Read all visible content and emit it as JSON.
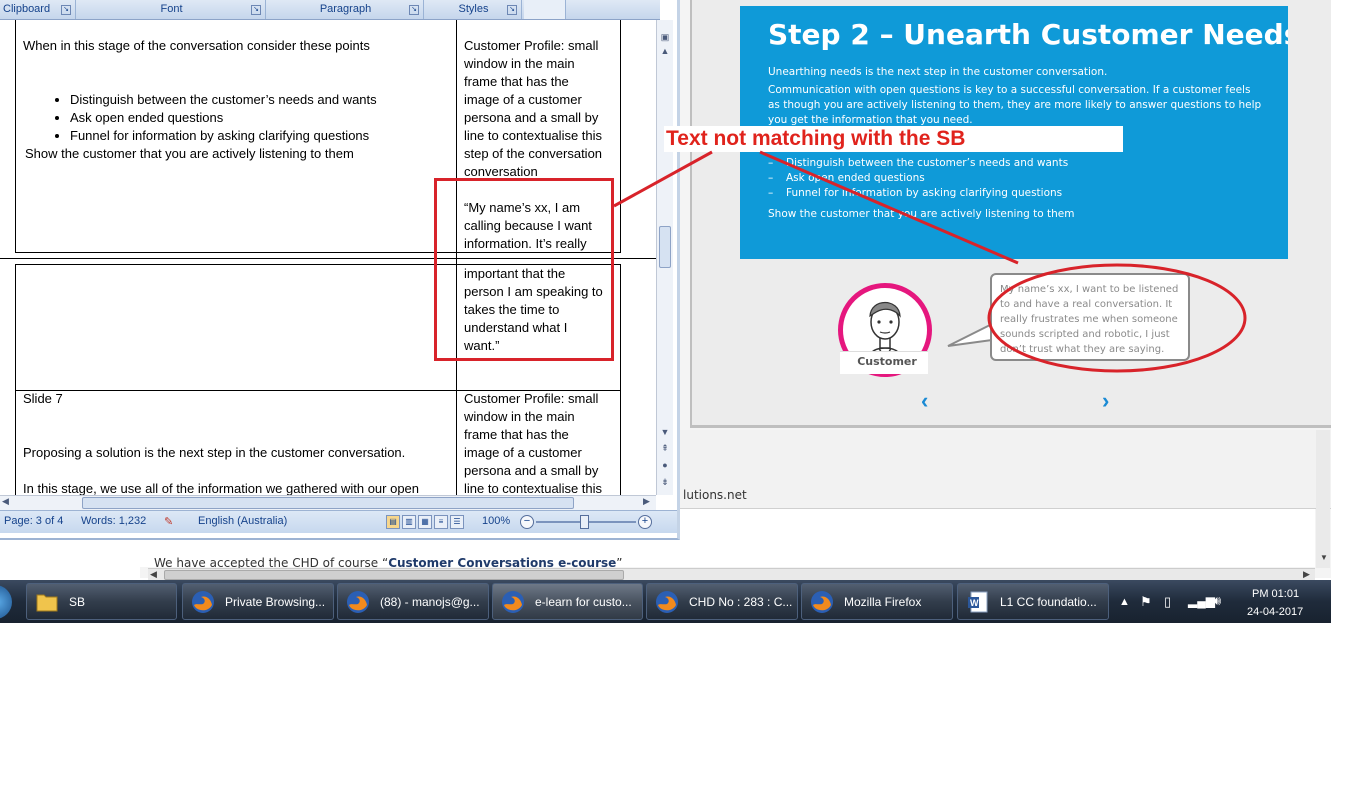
{
  "word": {
    "ribbon_groups": [
      "Clipboard",
      "Font",
      "Paragraph",
      "Styles"
    ],
    "row1": {
      "left_intro": "When in this stage of the conversation consider these points",
      "bullets": [
        "Distinguish between the customer’s needs and wants",
        "Ask open ended questions",
        "Funnel for information by asking clarifying questions"
      ],
      "left_outro": "Show the customer that you are actively listening to them",
      "right_lines": [
        "Customer Profile: small",
        "window in the main",
        "frame that has the",
        "image of a customer",
        "persona and a small by",
        "line to contextualise this",
        "step of the conversation",
        "conversation"
      ],
      "quote_lines_top": [
        "“My name’s xx, I am",
        "calling because I want",
        "information. It’s really"
      ],
      "quote_lines_bottom": [
        "important that the",
        "person I am speaking to",
        "takes the time to",
        "understand what I",
        "want.”"
      ]
    },
    "row3": {
      "title": "Slide 7",
      "line1": "Proposing a solution is the next step in the customer conversation.",
      "line2": "In this stage, we use all of the information we gathered with our open",
      "right_lines": [
        "Customer Profile: small",
        "window in the main",
        "frame that has the",
        "image of a customer",
        "persona and a small by",
        "line to contextualise this"
      ]
    },
    "status": {
      "page": "Page: 3 of 4",
      "words": "Words: 1,232",
      "language": "English (Australia)",
      "zoom": "100%"
    }
  },
  "elearn": {
    "title": "Step 2 – Unearth Customer Needs",
    "para1": "Unearthing needs is the next step in the customer conversation.",
    "para2_lines": [
      "Communication with open questions is key to a successful conversation. If a customer feels",
      "as though you are actively listening to them, they are more likely to answer questions to help",
      "you get the information that you need."
    ],
    "bullets": [
      "Distinguish between the customer’s needs and wants",
      "Ask open ended questions",
      "Funnel for information by asking clarifying questions"
    ],
    "closing": "Show the customer that you are actively listening to them",
    "avatar_label": "Customer",
    "bubble_lines": [
      "My name’s xx, I want to be listened",
      "to and have a real conversation. It",
      "really frustrates me when someone",
      "sounds scripted and robotic, I just",
      "don’t trust what they are saying."
    ]
  },
  "annotation": {
    "callout": "Text not matching with the SB",
    "color": "#e0231c"
  },
  "background": {
    "url_fragment": "lutions.net",
    "note_prefix": "We have accepted the CHD of course “",
    "note_bold": "Customer Conversations e-course",
    "note_suffix": "”"
  },
  "taskbar": {
    "buttons": [
      {
        "label": "SB",
        "icon": "folder-icon"
      },
      {
        "label": "Private Browsing...",
        "icon": "firefox-icon"
      },
      {
        "label": "(88) - manojs@g...",
        "icon": "firefox-icon"
      },
      {
        "label": "e-learn for custo...",
        "icon": "firefox-icon"
      },
      {
        "label": "CHD No : 283 : C...",
        "icon": "firefox-icon"
      },
      {
        "label": "Mozilla Firefox",
        "icon": "firefox-icon"
      },
      {
        "label": "L1 CC foundatio...",
        "icon": "word-doc-icon"
      }
    ],
    "clock_time": "PM 01:01",
    "clock_date": "24-04-2017"
  }
}
